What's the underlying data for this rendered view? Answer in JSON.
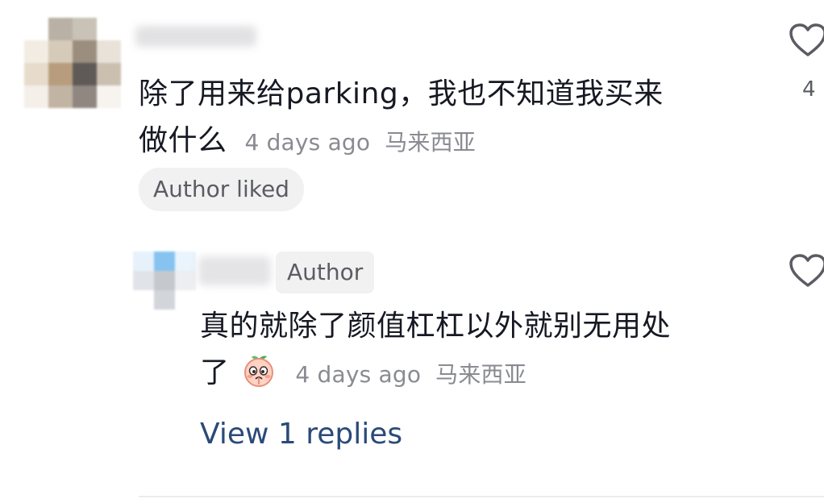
{
  "comment": {
    "text_line1": "除了用来给parking，我也不知道我买来",
    "text_line2": "做什么",
    "time": "4 days ago",
    "location": "马来西亚",
    "author_liked_label": "Author liked",
    "like_count": "4",
    "icons": {
      "like": "heart-outline-icon"
    }
  },
  "reply": {
    "author_tag": "Author",
    "text_line1": "真的就除了颜值杠杠以外就别无用处",
    "text_line2": "了",
    "emoji": "peach-emoji-icon",
    "time": "4 days ago",
    "location": "马来西亚",
    "icons": {
      "like": "heart-outline-icon"
    }
  },
  "view_replies_label": "View 1 replies",
  "colors": {
    "text": "#161823",
    "meta": "#8a8b91",
    "pill_bg": "#f1f1f2",
    "link": "#2b4a78",
    "divider": "#ececee"
  }
}
